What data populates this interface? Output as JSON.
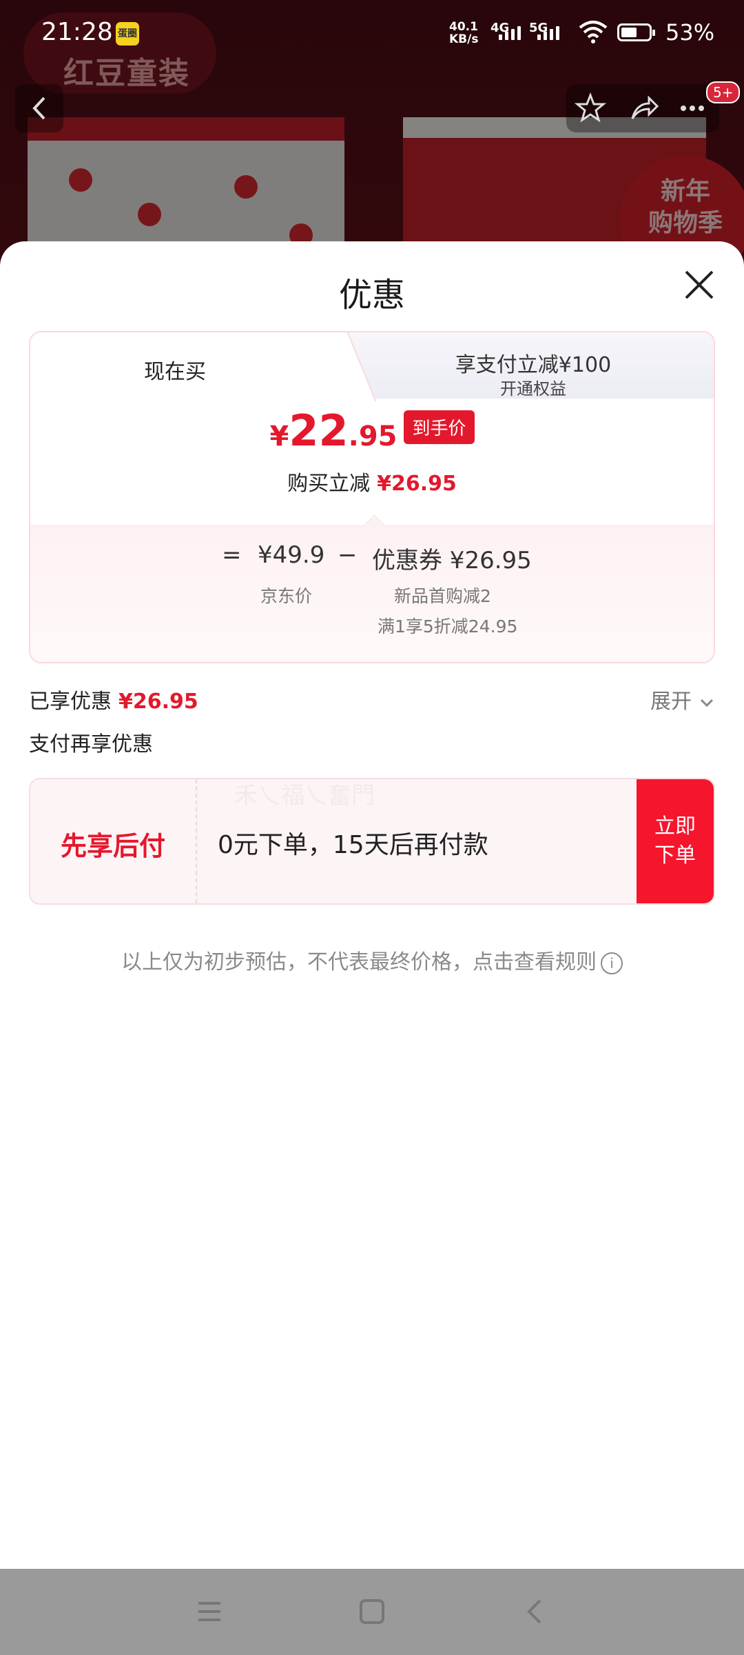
{
  "status_bar": {
    "time": "21:28",
    "app_badge": "蛋圈",
    "net_speed_top": "40.1",
    "net_speed_bottom": "KB/s",
    "signal1_label": "4G",
    "signal2_label": "5G",
    "battery": "53%"
  },
  "background": {
    "brand": "红豆童装",
    "season_badge_line1": "新年",
    "season_badge_line2": "购物季",
    "notification_count": "5+"
  },
  "sheet": {
    "title": "优惠",
    "tabs": {
      "left": "现在买",
      "right_main": "享支付立减¥100",
      "right_sub": "开通权益"
    },
    "price": {
      "yen": "¥",
      "integer": "22",
      "decimal": ".95",
      "badge": "到手价",
      "sub_label": "购买立减",
      "sub_value": "¥26.95"
    },
    "breakdown": {
      "equals": "=",
      "jd_price": "¥49.9",
      "minus": "−",
      "coupon": "优惠券 ¥26.95",
      "jd_label": "京东价",
      "coupon_detail1": "新品首购减2",
      "coupon_detail2": "满1享5折减24.95"
    },
    "enjoyed_label": "已享优惠",
    "enjoyed_value": "¥26.95",
    "expand_label": "展开",
    "pay_more_label": "支付再享优惠",
    "ghost_text": "禾乀福乀奮門",
    "bnpl": {
      "title": "先享后付",
      "desc": "0元下单，15天后再付款",
      "button_line1": "立即",
      "button_line2": "下单"
    },
    "disclaimer": "以上仅为初步预估，不代表最终价格，点击查看规则",
    "info_icon": "i"
  },
  "colors": {
    "accent_red": "#e4182d",
    "button_red": "#f5152c"
  }
}
